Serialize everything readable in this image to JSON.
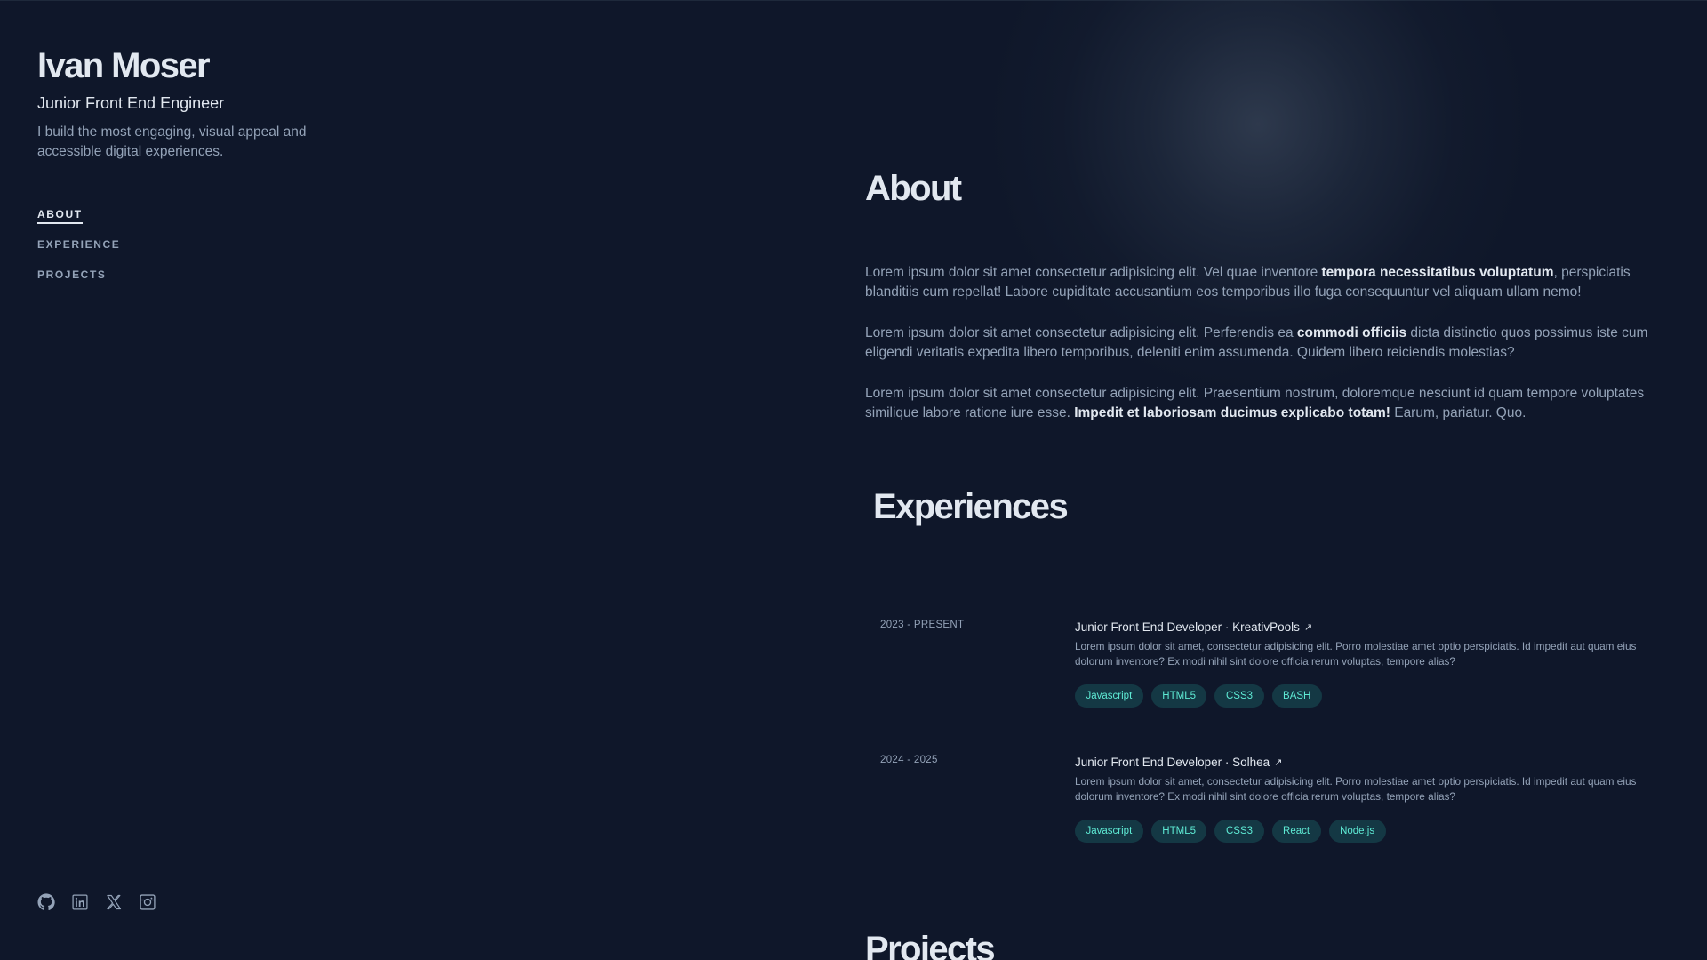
{
  "profile": {
    "name": "Ivan Moser",
    "role": "Junior Front End Engineer",
    "tagline": "I build the most engaging, visual appeal and accessible digital experiences."
  },
  "nav": {
    "items": [
      {
        "label": "ABOUT",
        "active": true
      },
      {
        "label": "EXPERIENCE",
        "active": false
      },
      {
        "label": "PROJECTS",
        "active": false
      }
    ]
  },
  "socials": [
    {
      "icon": "github-icon"
    },
    {
      "icon": "linkedin-icon"
    },
    {
      "icon": "x-twitter-icon"
    },
    {
      "icon": "instagram-icon"
    }
  ],
  "about": {
    "title": "About",
    "p1": {
      "a": "Lorem ipsum dolor sit amet consectetur adipisicing elit. Vel quae inventore ",
      "b": "tempora necessitatibus voluptatum",
      "c": ", perspiciatis blanditiis cum repellat! Labore cupiditate accusantium eos temporibus illo fuga consequuntur vel aliquam ullam nemo!"
    },
    "p2": {
      "a": "Lorem ipsum dolor sit amet consectetur adipisicing elit. Perferendis ea ",
      "b": "commodi officiis",
      "c": " dicta distinctio quos possimus iste cum eligendi veritatis expedita libero temporibus, deleniti enim assumenda. Quidem libero reiciendis molestias?"
    },
    "p3": {
      "a": "Lorem ipsum dolor sit amet consectetur adipisicing elit. Praesentium nostrum, doloremque nesciunt id quam tempore voluptates similique labore ratione iure esse. ",
      "b": "Impedit et laboriosam ducimus explicabo totam!",
      "c": " Earum, pariatur. Quo."
    }
  },
  "experience": {
    "title": "Experiences",
    "jobs": [
      {
        "dates": "2023 - PRESENT",
        "title": "Junior Front End Developer · KreativPools",
        "arrow": "↗",
        "desc": "Lorem ipsum dolor sit amet, consectetur adipisicing elit. Porro molestiae amet optio perspiciatis. Id impedit aut quam eius dolorum inventore? Ex modi nihil sint dolore officia rerum voluptas, tempore alias?",
        "tags": [
          "Javascript",
          "HTML5",
          "CSS3",
          "BASH"
        ]
      },
      {
        "dates": "2024 - 2025",
        "title": "Junior Front End Developer · Solhea",
        "arrow": "↗",
        "desc": "Lorem ipsum dolor sit amet, consectetur adipisicing elit. Porro molestiae amet optio perspiciatis. Id impedit aut quam eius dolorum inventore? Ex modi nihil sint dolore officia rerum voluptas, tempore alias?",
        "tags": [
          "Javascript",
          "HTML5",
          "CSS3",
          "React",
          "Node.js"
        ]
      }
    ]
  },
  "projects": {
    "title": "Projects"
  },
  "colors": {
    "background": "#0f172a",
    "heading": "#e2e8f0",
    "body": "#94a3b8",
    "tag_text": "#5eead4"
  }
}
